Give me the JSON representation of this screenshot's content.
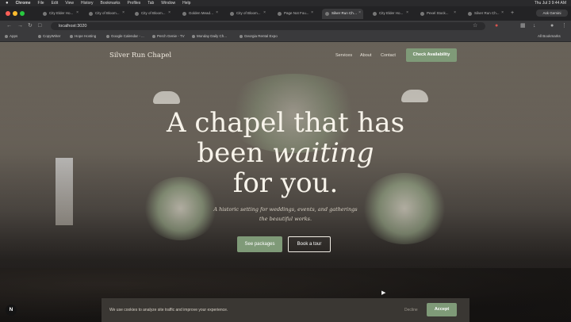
{
  "menubar": {
    "app": "Chrome",
    "items": [
      "File",
      "Edit",
      "View",
      "History",
      "Bookmarks",
      "Profiles",
      "Tab",
      "Window",
      "Help"
    ],
    "clock": "Thu Jul 3  9:44 AM"
  },
  "tabs": [
    {
      "label": "City Elder Ho..."
    },
    {
      "label": "City of Bloom..."
    },
    {
      "label": "City of Bloom..."
    },
    {
      "label": "Golden Meado..."
    },
    {
      "label": "City of Bloom..."
    },
    {
      "label": "Page Not Fou..."
    },
    {
      "label": "Silver Run Cha..."
    },
    {
      "label": "City Elder Ho..."
    },
    {
      "label": "Pexel Stock..."
    },
    {
      "label": "Silver Run Ch..."
    }
  ],
  "browser": {
    "url": "localhost:3020",
    "ask_label": "Ask Gemini"
  },
  "bookmarks": [
    {
      "label": "Apps"
    },
    {
      "label": "CopyWriter"
    },
    {
      "label": "Hope Hosting"
    },
    {
      "label": "Google Calendar - ..."
    },
    {
      "label": "Perch Genie - TV"
    },
    {
      "label": "Monday Daily Ch..."
    },
    {
      "label": "Georgia Rental Expo"
    }
  ],
  "bookmarks_all": "All Bookmarks",
  "site": {
    "logo": "Silver Run Chapel",
    "nav": [
      "Services",
      "About",
      "Contact"
    ],
    "cta": "Check Availability",
    "hero_line1": "A chapel that has",
    "hero_line2a": "been ",
    "hero_line2b": "waiting",
    "hero_line3": "for you.",
    "sub_line1": "A historic setting for weddings, events, and gatherings",
    "sub_line2": "the beautiful works.",
    "btn_primary": "See packages",
    "btn_secondary": "Book a tour",
    "badge": "N"
  },
  "cookie": {
    "text": "We use cookies to analyze site traffic and improve your experience.",
    "decline": "Decline",
    "accept": "Accept"
  },
  "colors": {
    "accent": "#7f9a78",
    "text_light": "#f7f3ea"
  }
}
